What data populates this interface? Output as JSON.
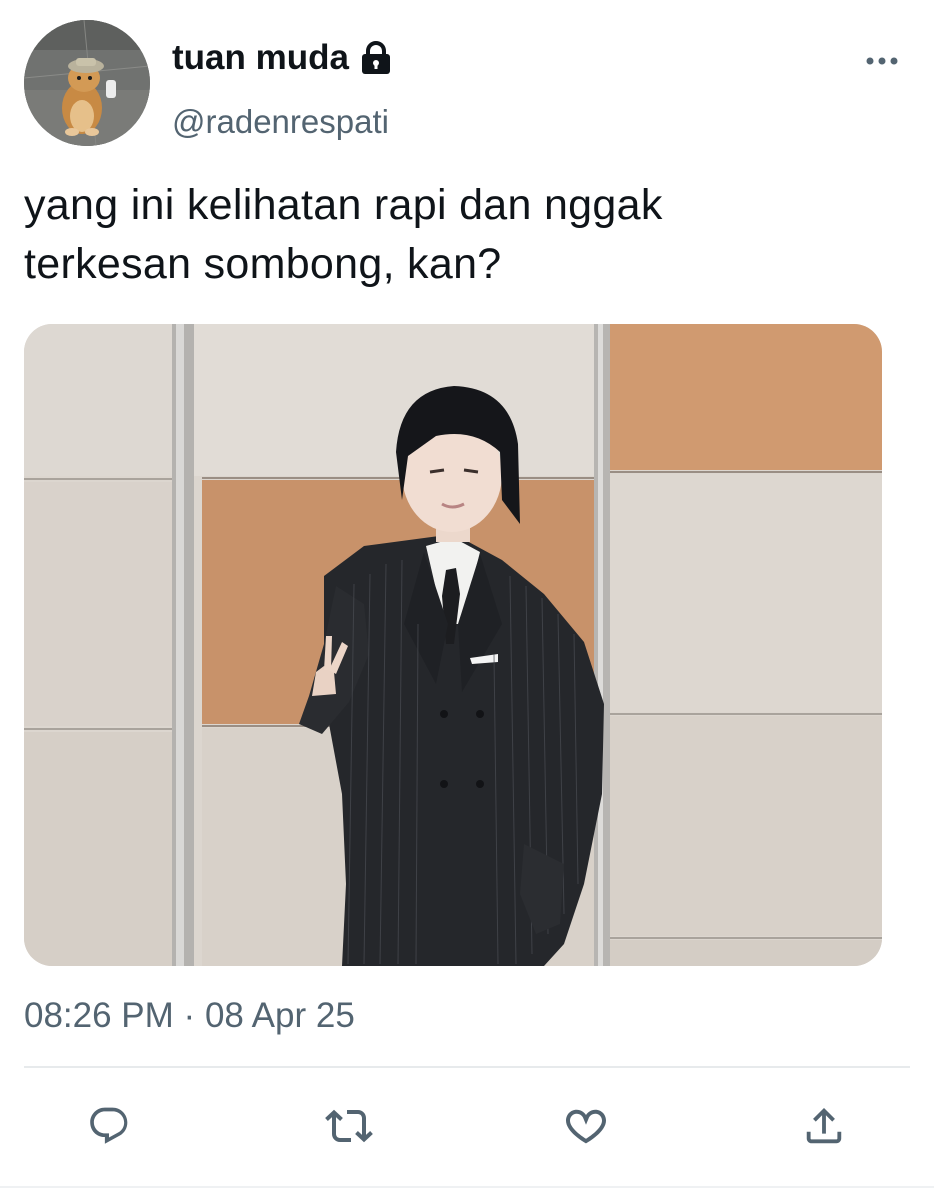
{
  "author": {
    "display_name": "tuan muda",
    "handle": "@radenrespati",
    "protected": true
  },
  "tweet": {
    "text_lines": [
      "yang ini kelihatan rapi dan nggak",
      "terkesan sombong, kan?"
    ],
    "time": "08:26 PM",
    "separator": "·",
    "date": "08 Apr 25"
  },
  "icons": {
    "lock": "lock-icon",
    "more": "more-horizontal-icon",
    "reply": "reply-icon",
    "retweet": "retweet-icon",
    "like": "heart-icon",
    "share": "share-icon"
  },
  "colors": {
    "text_primary": "#0f1419",
    "text_secondary": "#536471",
    "icon": "#536471",
    "divider": "#e7eaec"
  }
}
